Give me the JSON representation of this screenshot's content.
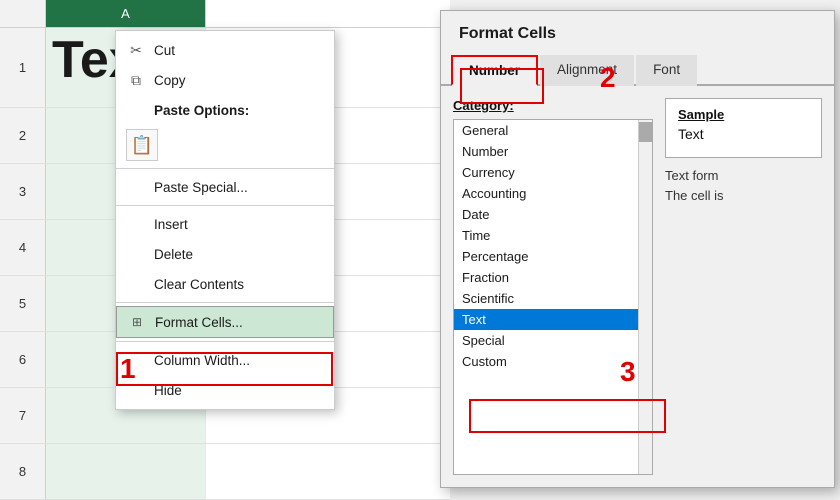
{
  "spreadsheet": {
    "col_a_header": "A",
    "big_text": "Tex",
    "row_numbers": [
      "1",
      "2",
      "3",
      "4",
      "5",
      "6",
      "7",
      "8"
    ]
  },
  "context_menu": {
    "cut_label": "Cut",
    "copy_label": "Copy",
    "paste_options_label": "Paste Options:",
    "paste_special_label": "Paste Special...",
    "insert_label": "Insert",
    "delete_label": "Delete",
    "clear_contents_label": "Clear Contents",
    "format_cells_label": "Format Cells...",
    "column_width_label": "Column Width...",
    "hide_label": "Hide"
  },
  "dialog": {
    "title": "Format Cells",
    "tabs": [
      "Number",
      "Alignment",
      "Font"
    ],
    "active_tab": "Number",
    "category_label": "Category:",
    "categories": [
      "General",
      "Number",
      "Currency",
      "Accounting",
      "Date",
      "Time",
      "Percentage",
      "Fraction",
      "Scientific",
      "Text",
      "Special",
      "Custom"
    ],
    "selected_category": "Text",
    "sample_label": "Sample",
    "sample_value": "Text",
    "description_line1": "Text form",
    "description_line2": "The cell is"
  },
  "annotations": {
    "one": "1",
    "two": "2",
    "three": "3"
  }
}
